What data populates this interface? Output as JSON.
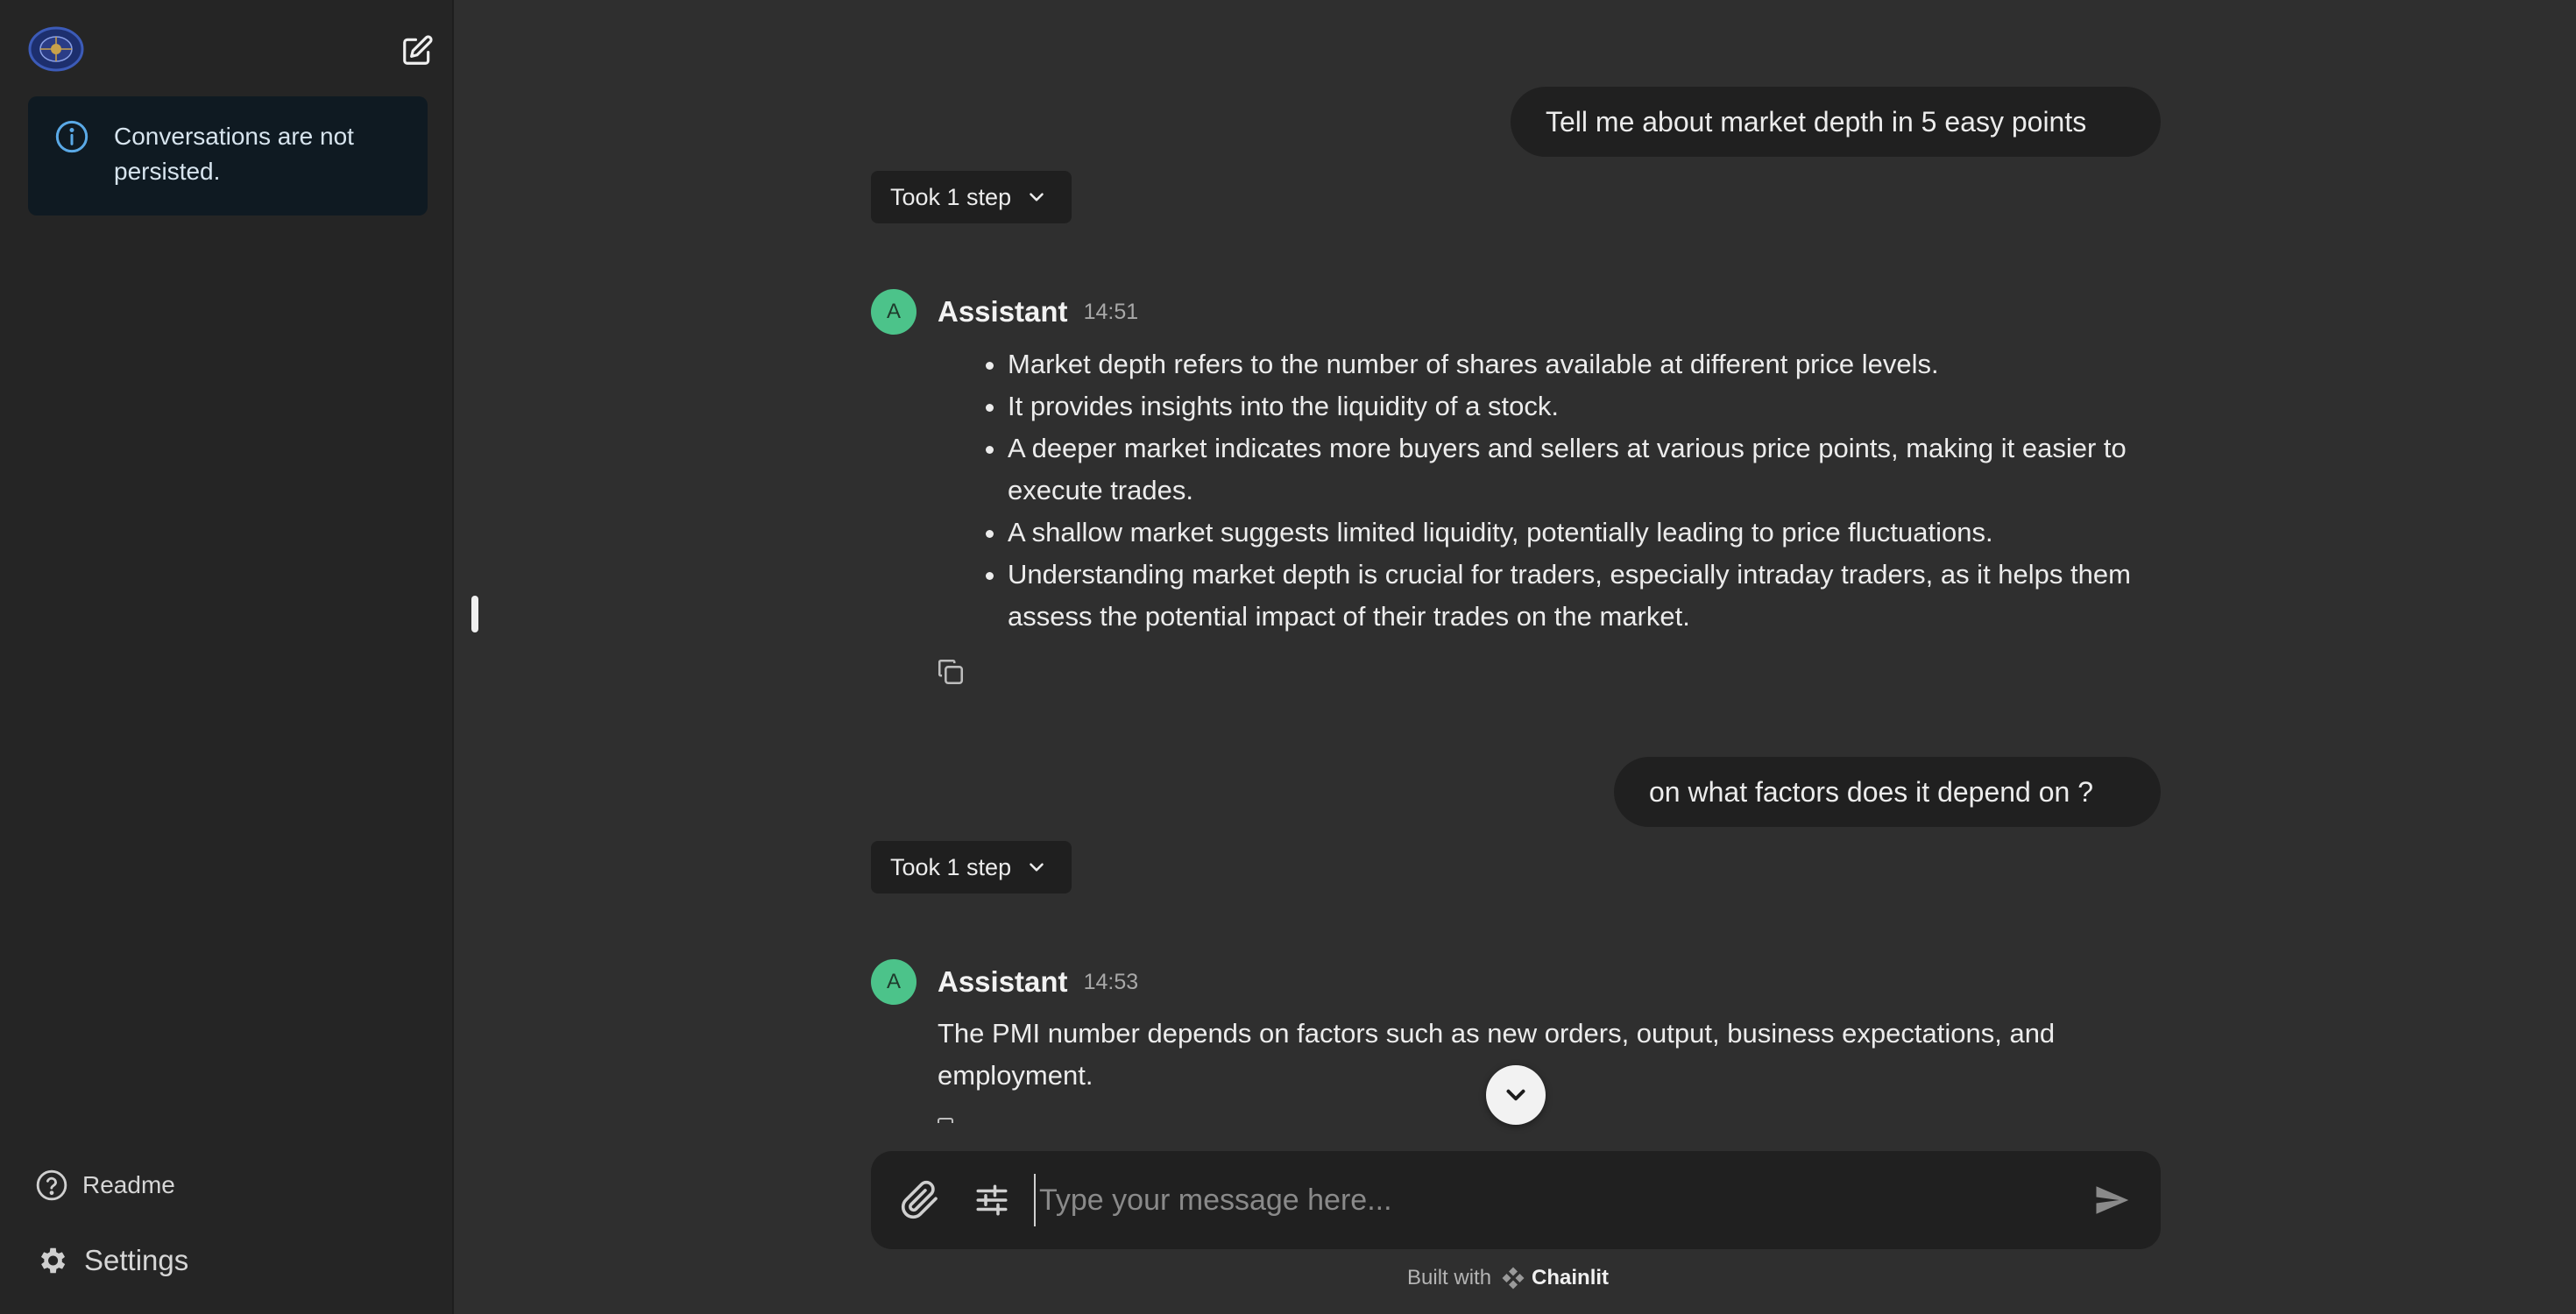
{
  "sidebar": {
    "notice": "Conversations are not persisted.",
    "readme_label": "Readme",
    "settings_label": "Settings"
  },
  "conversation": {
    "user_message_1": "Tell me about market depth in 5 easy points",
    "steps_label_1": "Took 1 step",
    "assistant_1": {
      "author": "Assistant",
      "time": "14:51",
      "bullets": [
        "Market depth refers to the number of shares available at different price levels.",
        "It provides insights into the liquidity of a stock.",
        "A deeper market indicates more buyers and sellers at various price points, making it easier to execute trades.",
        "A shallow market suggests limited liquidity, potentially leading to price fluctuations.",
        "Understanding market depth is crucial for traders, especially intraday traders, as it helps them assess the potential impact of their trades on the market."
      ]
    },
    "user_message_2": "on what factors does it depend on ?",
    "steps_label_2": "Took 1 step",
    "assistant_2": {
      "author": "Assistant",
      "time": "14:53",
      "text": "The PMI number depends on factors such as new orders, output, business expectations, and employment."
    }
  },
  "composer": {
    "placeholder": "Type your message here..."
  },
  "footer": {
    "built_with": "Built with",
    "brand": "Chainlit"
  },
  "avatar_letter": "A",
  "colors": {
    "background": "#2f2f2f",
    "sidebar": "#252525",
    "bubble": "#202020",
    "avatar": "#4cc38a",
    "notice_bg": "#0f1a22",
    "info_accent": "#5aa9e6"
  }
}
